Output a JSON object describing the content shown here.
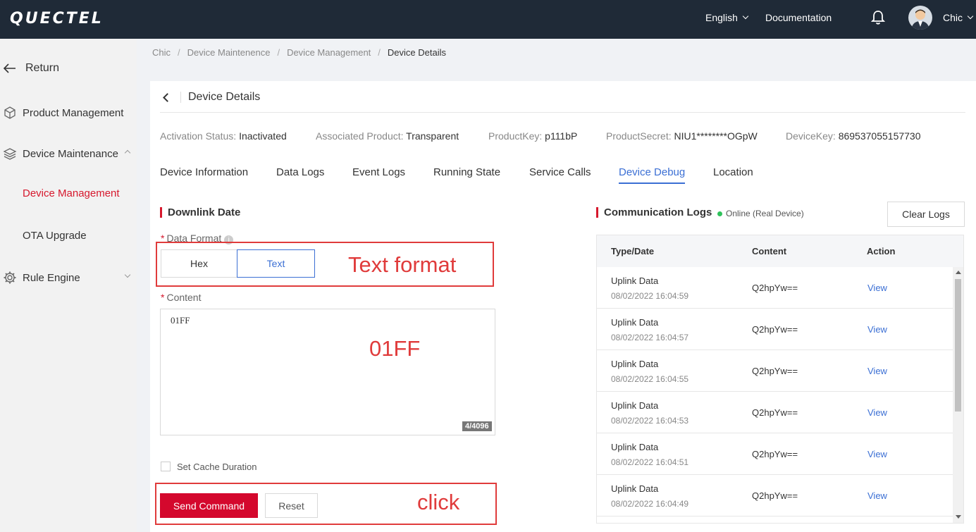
{
  "topbar": {
    "logo": "QUECTEL",
    "language": "English",
    "documentation": "Documentation",
    "user": "Chic"
  },
  "sidebar": {
    "return_label": "Return",
    "items": [
      {
        "label": "Product Management"
      },
      {
        "label": "Device Maintenance"
      },
      {
        "label": "Device Management"
      },
      {
        "label": "OTA Upgrade"
      },
      {
        "label": "Rule Engine"
      }
    ]
  },
  "breadcrumb": [
    "Chic",
    "Device Maintenence",
    "Device Management",
    "Device Details"
  ],
  "page_title": "Device Details",
  "info": {
    "activation_label": "Activation Status:",
    "activation_value": "Inactivated",
    "product_label": "Associated Product:",
    "product_value": "Transparent",
    "productkey_label": "ProductKey:",
    "productkey_value": "p111bP",
    "productsecret_label": "ProductSecret:",
    "productsecret_value": "NIU1********OGpW",
    "devicekey_label": "DeviceKey:",
    "devicekey_value": "869537055157730"
  },
  "tabs": [
    "Device Information",
    "Data Logs",
    "Event Logs",
    "Running State",
    "Service Calls",
    "Device Debug",
    "Location"
  ],
  "downlink": {
    "title": "Downlink Date",
    "format_label": "Data Format",
    "format_options": [
      "Hex",
      "Text"
    ],
    "content_label": "Content",
    "content_value": "01FF",
    "counter": "4/4096",
    "cache_label": "Set Cache Duration",
    "send_button": "Send Command",
    "reset_button": "Reset"
  },
  "annotations": {
    "text_format": "Text format",
    "content": "01FF",
    "click": "click"
  },
  "logs": {
    "title": "Communication Logs",
    "status": "Online (Real Device)",
    "clear_button": "Clear Logs",
    "headers": [
      "Type/Date",
      "Content",
      "Action"
    ],
    "rows": [
      {
        "type": "Uplink Data",
        "date": "08/02/2022 16:04:59",
        "content": "Q2hpYw==",
        "action": "View"
      },
      {
        "type": "Uplink Data",
        "date": "08/02/2022 16:04:57",
        "content": "Q2hpYw==",
        "action": "View"
      },
      {
        "type": "Uplink Data",
        "date": "08/02/2022 16:04:55",
        "content": "Q2hpYw==",
        "action": "View"
      },
      {
        "type": "Uplink Data",
        "date": "08/02/2022 16:04:53",
        "content": "Q2hpYw==",
        "action": "View"
      },
      {
        "type": "Uplink Data",
        "date": "08/02/2022 16:04:51",
        "content": "Q2hpYw==",
        "action": "View"
      },
      {
        "type": "Uplink Data",
        "date": "08/02/2022 16:04:49",
        "content": "Q2hpYw==",
        "action": "View"
      }
    ]
  },
  "colors": {
    "accent": "#d6182d",
    "link": "#3b6fd4",
    "topbar": "#1f2a37",
    "annotation": "#e03b3b"
  }
}
